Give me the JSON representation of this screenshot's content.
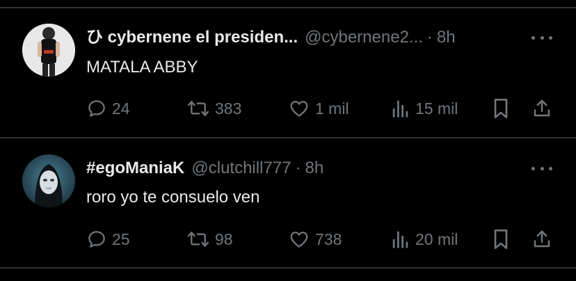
{
  "tweets": [
    {
      "name_icon": "ひ",
      "name": "cybernene el presiden...",
      "handle": "@cybernene2...",
      "separator": "·",
      "time": "8h",
      "text": "MATALA ABBY",
      "replies": "24",
      "retweets": "383",
      "likes": "1 mil",
      "views": "15 mil"
    },
    {
      "name": "#egoManiaK",
      "handle": "@clutchill777",
      "separator": "·",
      "time": "8h",
      "text": "roro yo te consuelo ven",
      "replies": "25",
      "retweets": "98",
      "likes": "738",
      "views": "20 mil"
    }
  ],
  "colors": {
    "background": "#000000",
    "text_primary": "#e7e9ea",
    "text_secondary": "#71767b",
    "divider": "#2f3336"
  },
  "icons": [
    "reply-icon",
    "retweet-icon",
    "like-icon",
    "views-icon",
    "bookmark-icon",
    "share-icon",
    "more-icon"
  ]
}
